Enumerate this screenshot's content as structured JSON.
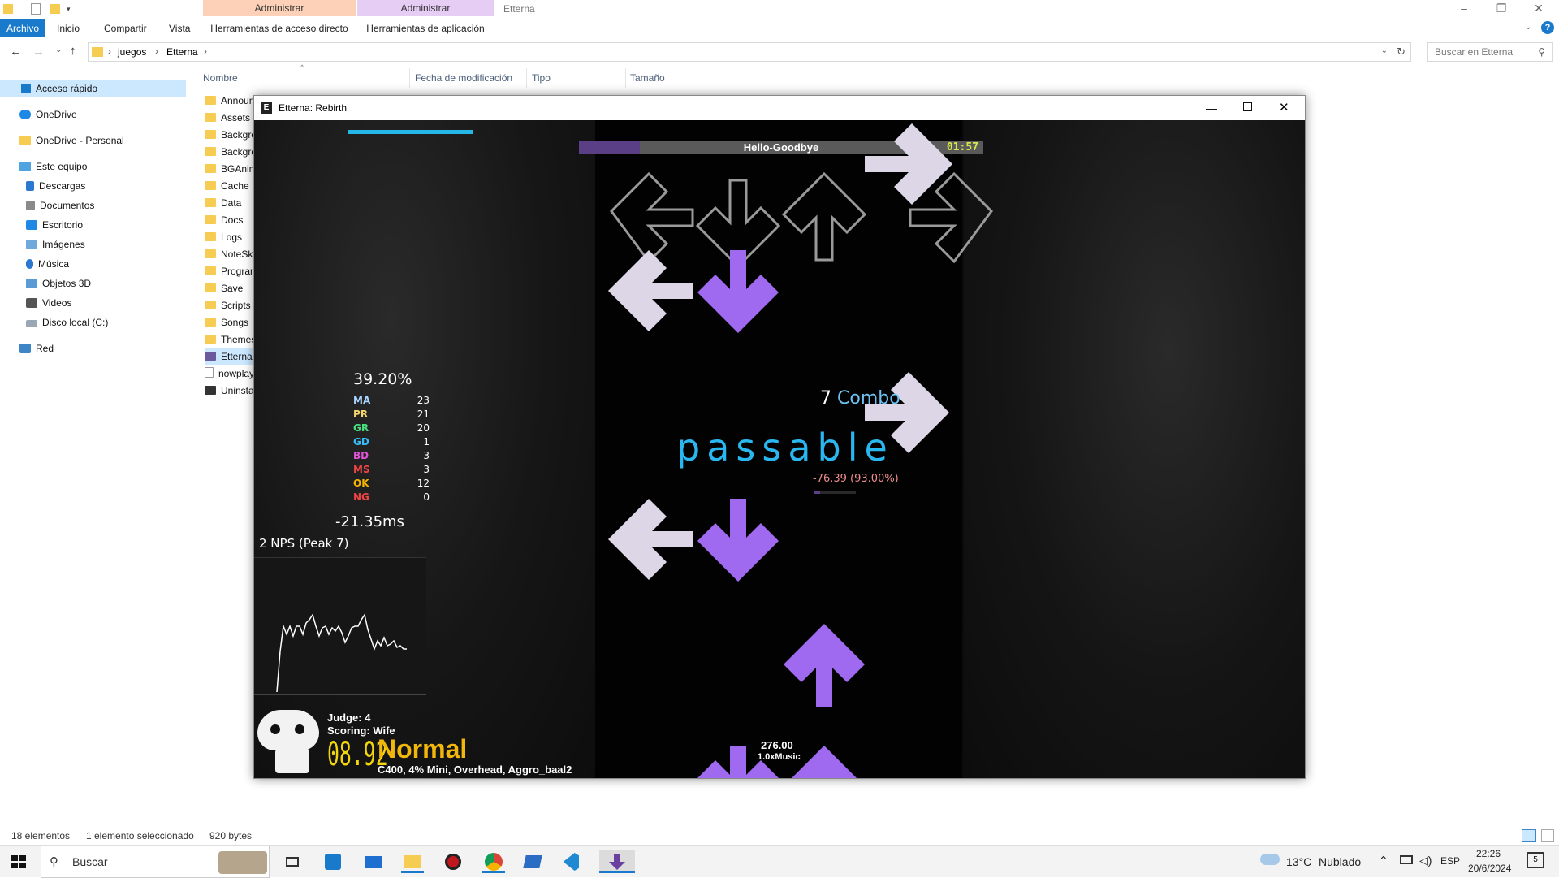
{
  "explorer": {
    "ribbon": {
      "archivo": "Archivo",
      "tabs": [
        "Inicio",
        "Compartir",
        "Vista"
      ],
      "ctx1_header": "Administrar",
      "ctx1_sub": "Herramientas de acceso directo",
      "ctx2_header": "Administrar",
      "ctx2_sub": "Herramientas de aplicación",
      "window_title": "Etterna"
    },
    "address": {
      "crumb1": "juegos",
      "crumb2": "Etterna"
    },
    "search_placeholder": "Buscar en Etterna",
    "nav": {
      "quick_access": "Acceso rápido",
      "onedrive": "OneDrive",
      "onedrive_personal": "OneDrive - Personal",
      "this_pc": "Este equipo",
      "downloads": "Descargas",
      "documents": "Documentos",
      "desktop": "Escritorio",
      "images": "Imágenes",
      "music": "Música",
      "objects3d": "Objetos 3D",
      "videos": "Videos",
      "local_disk": "Disco local (C:)",
      "network": "Red"
    },
    "columns": {
      "name": "Nombre",
      "modified": "Fecha de modificación",
      "type": "Tipo",
      "size": "Tamaño"
    },
    "files": [
      "Announ",
      "Assets",
      "Backgro",
      "Backgro",
      "BGAnim",
      "Cache",
      "Data",
      "Docs",
      "Logs",
      "NoteSki",
      "Progran",
      "Save",
      "Scripts",
      "Songs",
      "Themes",
      "Etterna",
      "nowplay",
      "Uninsta"
    ],
    "status": {
      "count": "18 elementos",
      "selected": "1 elemento seleccionado",
      "size": "920 bytes"
    }
  },
  "game": {
    "window_title": "Etterna: Rebirth",
    "song_title": "Hello-Goodbye",
    "time_remaining": "01:57",
    "song_progress": 0.15,
    "life_bar": 1.0,
    "percent": "39.20%",
    "judgments": [
      {
        "label": "MA",
        "value": "23",
        "color": "#a8d4ff"
      },
      {
        "label": "PR",
        "value": "21",
        "color": "#f5d76e"
      },
      {
        "label": "GR",
        "value": "20",
        "color": "#4ade80"
      },
      {
        "label": "GD",
        "value": "1",
        "color": "#38bdf8"
      },
      {
        "label": "BD",
        "value": "3",
        "color": "#e055d5"
      },
      {
        "label": "MS",
        "value": "3",
        "color": "#ef4444"
      },
      {
        "label": "OK",
        "value": "12",
        "color": "#f5b400"
      },
      {
        "label": "NG",
        "value": "0",
        "color": "#ef4444"
      }
    ],
    "mean_offset": "-21.35ms",
    "nps": "2 NPS (Peak 7)",
    "combo_count": "7",
    "combo_label": "Combo",
    "judgment_text": "passable",
    "offset_text": "-76.39 (93.00%)",
    "judge": "Judge: 4",
    "scoring": "Scoring: Wife",
    "msd": "08.92",
    "difficulty": "Normal",
    "mods": "C400, 4% Mini, Overhead, Aggro_baal2",
    "bpm": "276.00",
    "rate": "1.0xMusic",
    "colors": {
      "note_purple": "#9f6af0",
      "note_white": "#dcd6e6",
      "judge_blue": "#2ab7f0",
      "msd_yellow": "#f2d60b"
    }
  },
  "taskbar": {
    "search": "Buscar",
    "weather_temp": "13°C",
    "weather_desc": "Nublado",
    "lang": "ESP",
    "time": "22:26",
    "date": "20/6/2024",
    "notifications": "5"
  }
}
